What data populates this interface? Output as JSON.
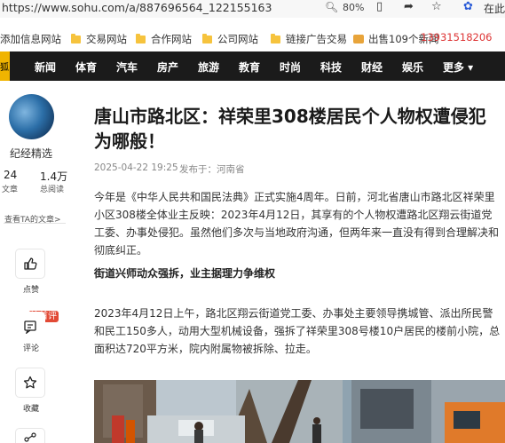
{
  "browser": {
    "url": "https://www.sohu.com/a/887696564_122155163",
    "zoom": "80%",
    "more_text": "在此"
  },
  "bookmarks": [
    {
      "label": "添加信息网站",
      "type": "text"
    },
    {
      "label": "交易网站",
      "type": "folder"
    },
    {
      "label": "合作网站",
      "type": "folder"
    },
    {
      "label": "公司网站",
      "type": "folder"
    },
    {
      "label": "链接广告交易",
      "type": "folder"
    },
    {
      "label": "出售109个新闻",
      "type": "ad"
    }
  ],
  "bookmark_phone": "13931518206",
  "nav": {
    "logo": "狐",
    "items": [
      "新闻",
      "体育",
      "汽车",
      "房产",
      "旅游",
      "教育",
      "时尚",
      "科技",
      "财经",
      "娱乐",
      "更多 ▾"
    ]
  },
  "sidebar": {
    "author": "纪经精选",
    "stats": [
      {
        "num": "24",
        "label": "文章"
      },
      {
        "num": "1.4万",
        "label": "总阅读"
      }
    ],
    "link": "查看TA的文章>",
    "actions": [
      {
        "icon": "thumb-up-icon",
        "label": "点赞"
      },
      {
        "icon": "comment-icon",
        "label": "评论"
      },
      {
        "icon": "star-icon",
        "label": "收藏"
      }
    ],
    "comment_badge": "抢首评"
  },
  "article": {
    "title": "唐山市路北区：祥荣里308楼居民个人物权遭侵犯为哪般！",
    "date": "2025-04-22 19:25",
    "source": "发布于：河南省",
    "para1": "今年是《中华人民共和国民法典》正式实施4周年。日前，河北省唐山市路北区祥荣里小区308楼全体业主反映：2023年4月12日，其享有的个人物权遭路北区翔云街道党工委、办事处侵犯。虽然他们多次与当地政府沟通，但两年来一直没有得到合理解决和彻底纠正。",
    "subhead": "街道兴师动众强拆，业主据理力争维权",
    "para2": "2023年4月12日上午，路北区翔云街道党工委、办事处主要领导携城管、派出所民警和民工150多人，动用大型机械设备，强拆了祥荣里308号楼10户居民的楼前小院，总面积达720平方米，院内附属物被拆除、拉走。"
  },
  "colors": {
    "nav_bg": "#1b1b1b",
    "logo_bg": "#f0b400",
    "badge": "#e24a36",
    "folder": "#f6c33d"
  }
}
